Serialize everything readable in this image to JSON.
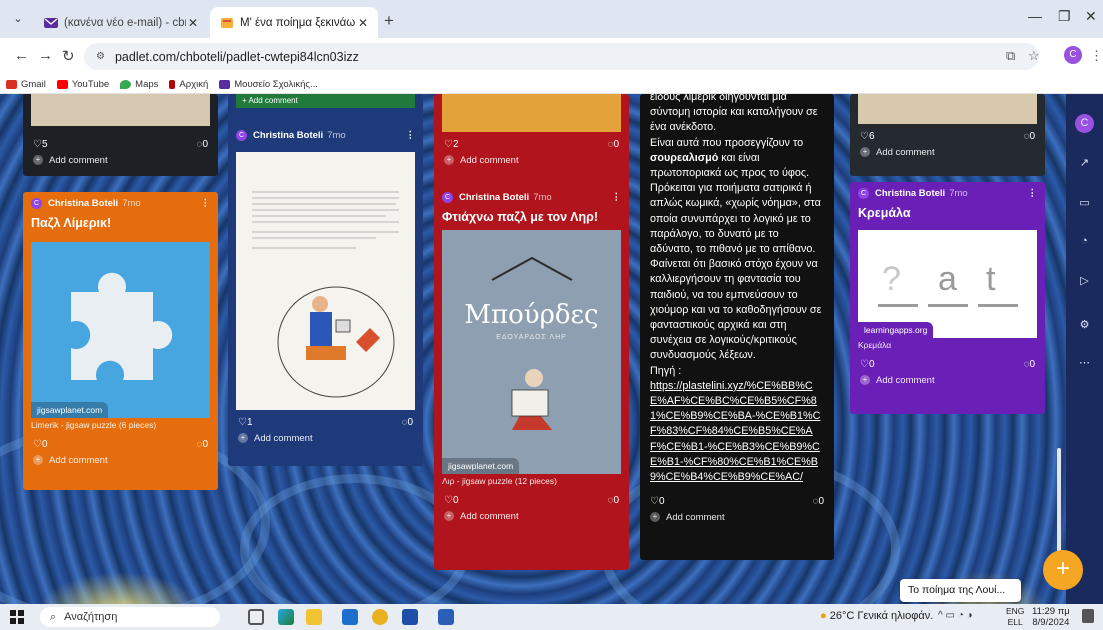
{
  "browser": {
    "tabs": [
      {
        "title": "(κανένα νέο e-mail) - cbnip@y...",
        "active": false
      },
      {
        "title": "Μ' ένα ποίημα ξεκινάω και τον...",
        "active": true
      }
    ],
    "new_tab": "+",
    "url": "padlet.com/chboteli/padlet-cwtepi84lcn03izz",
    "bookmarks": [
      "Gmail",
      "YouTube",
      "Maps",
      "Αρχική",
      "Μουσείο Σχολικής..."
    ],
    "profile_letter": "C"
  },
  "posts": {
    "top_left": {
      "likes": "5",
      "comments": "0",
      "add_comment": "Add comment"
    },
    "orange": {
      "author": "Christina Boteli",
      "ago": "7mo",
      "title": "Παζλ Λίμερικ!",
      "source": "jigsawplanet.com",
      "caption": "Limerik - jigsaw puzzle (6 pieces)",
      "likes": "0",
      "comments": "0",
      "add_comment": "Add comment"
    },
    "gray": {
      "top_add_comment": "Add comment",
      "author": "Christina Boteli",
      "ago": "7mo",
      "likes": "1",
      "comments": "0",
      "add_comment": "Add comment"
    },
    "red": {
      "top_likes": "2",
      "top_comments": "0",
      "top_add_comment": "Add comment",
      "author": "Christina Boteli",
      "ago": "7mo",
      "title": "Φτιάχνω παζλ με τον Ληρ!",
      "book_title": "Μπούρδες",
      "book_author": "ΕΔΟΥΑΡΔΟΣ ΛΗΡ",
      "source": "jigsawplanet.com",
      "caption": "Λιρ - jigsaw puzzle (12 pieces)",
      "likes": "0",
      "comments": "0",
      "add_comment": "Add comment"
    },
    "text": {
      "line_intro": "είδους λίμερικ διηγούνται μια σύντομη ιστορία και καταλήγουν σε ένα ανέκδοτο.",
      "line_a": "Είναι αυτά που προσεγγίζουν το ",
      "bold": "σουρεαλισμό",
      "line_b": " και είναι πρωτοποριακά ως προς το ύφος. Πρόκειται για ποιήματα σατιρικά ή απλώς κωμικά, «χωρίς νόημα», στα οποία συνυπάρχει το λογικό με το παράλογο, το δυνατό με το αδύνατο, το πιθανό με το απίθανο. Φαίνεται ότι βασικό στόχο έχουν να καλλιεργήσουν τη φαντασία του παιδιού, να του εμπνεύσουν το χιούμορ και να το καθοδηγήσουν σε φανταστικούς αρχικά και στη συνέχεια σε λογικούς/κριτικούς συνδυασμούς λέξεων.",
      "source_label": "Πηγή :",
      "link": "https://plastelini.xyz/%CE%BB%CE%AF%CE%BC%CE%B5%CF%81%CE%B9%CE%BA-%CE%B1%CF%83%CF%84%CE%B5%CE%AF%CE%B1-%CE%B3%CE%B9%CE%B1-%CF%80%CE%B1%CE%B9%CE%B4%CE%B9%CE%AC/",
      "likes": "0",
      "comments": "0",
      "add_comment": "Add comment"
    },
    "top_right": {
      "likes": "6",
      "comments": "0",
      "add_comment": "Add comment"
    },
    "purple": {
      "author": "Christina Boteli",
      "ago": "7mo",
      "title": "Κρεμάλα",
      "hangman_1": "?",
      "hangman_2": "a",
      "hangman_3": "t",
      "source": "learningapps.org",
      "caption": "Κρεμάλα",
      "likes": "0",
      "comments": "0",
      "add_comment": "Add comment"
    }
  },
  "tooltip": "Το ποίημα της Λουί...",
  "taskbar": {
    "search": "Αναζήτηση",
    "weather": "26°C  Γενικά ηλιοφάν.",
    "lang_1": "ENG",
    "lang_2": "ELL",
    "time": "11:29 πμ",
    "date": "8/9/2024"
  },
  "colors": {
    "accent": "#9b51e0",
    "fab": "#f5a623",
    "orange_card": "#e56d0d",
    "red_card": "#b1141c",
    "purple_card": "#6a20b6"
  }
}
